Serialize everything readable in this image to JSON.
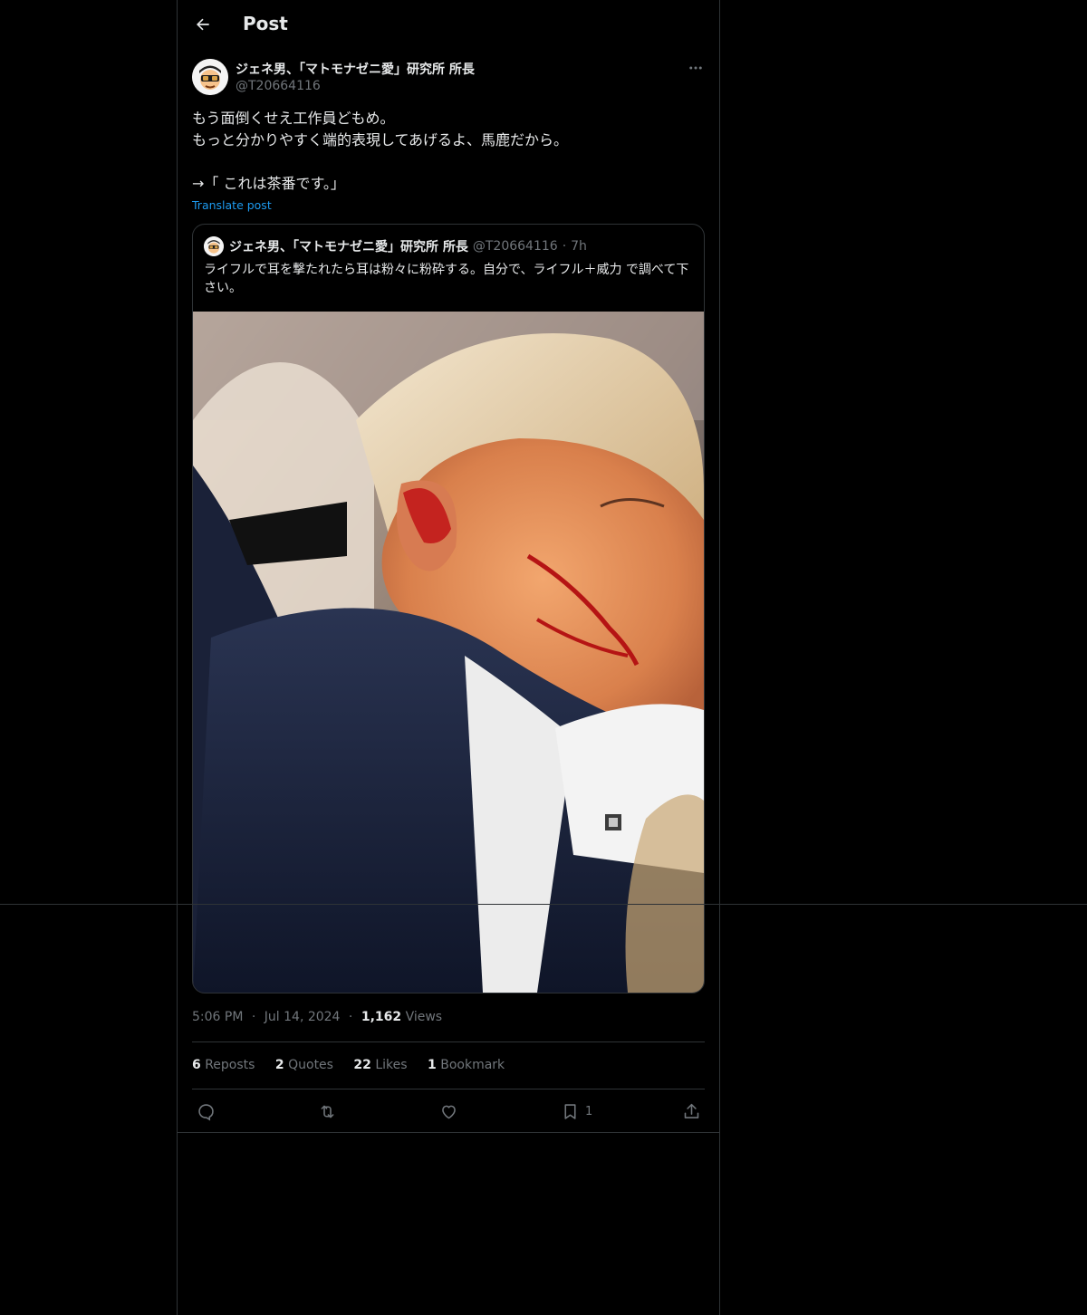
{
  "header": {
    "title": "Post"
  },
  "post": {
    "author_name": "ジェネ男、「マトモナゼニ愛」研究所 所長",
    "handle": "@T20664116",
    "lines": [
      "もう面倒くせえ工作員どもめ。",
      "もっと分かりやすく端的表現してあげるよ、馬鹿だから。",
      "",
      "→「 これは茶番です。」"
    ],
    "translate_label": "Translate post"
  },
  "quote": {
    "author_name": "ジェネ男、「マトモナゼニ愛」研究所 所長",
    "handle": "@T20664116",
    "dot": "·",
    "time": "7h",
    "text": "ライフルで耳を撃たれたら耳は粉々に粉砕する。自分で、ライフル＋威力 で調べて下さい。"
  },
  "meta": {
    "time": "5:06 PM",
    "dot": "·",
    "date": "Jul 14, 2024",
    "views_count": "1,162",
    "views_label": "Views"
  },
  "stats": {
    "reposts_count": "6",
    "reposts_label": "Reposts",
    "quotes_count": "2",
    "quotes_label": "Quotes",
    "likes_count": "22",
    "likes_label": "Likes",
    "bookmarks_count": "1",
    "bookmarks_label": "Bookmark"
  },
  "actions": {
    "reply_icon": "reply-icon",
    "repost_icon": "repost-icon",
    "like_icon": "heart-icon",
    "bookmark_icon": "bookmark-icon",
    "bookmark_count": "1",
    "share_icon": "share-icon"
  },
  "colors": {
    "background": "#000000",
    "text": "#e7e9ea",
    "muted": "#71767b",
    "link": "#1d9bf0",
    "border": "#2f3336"
  }
}
